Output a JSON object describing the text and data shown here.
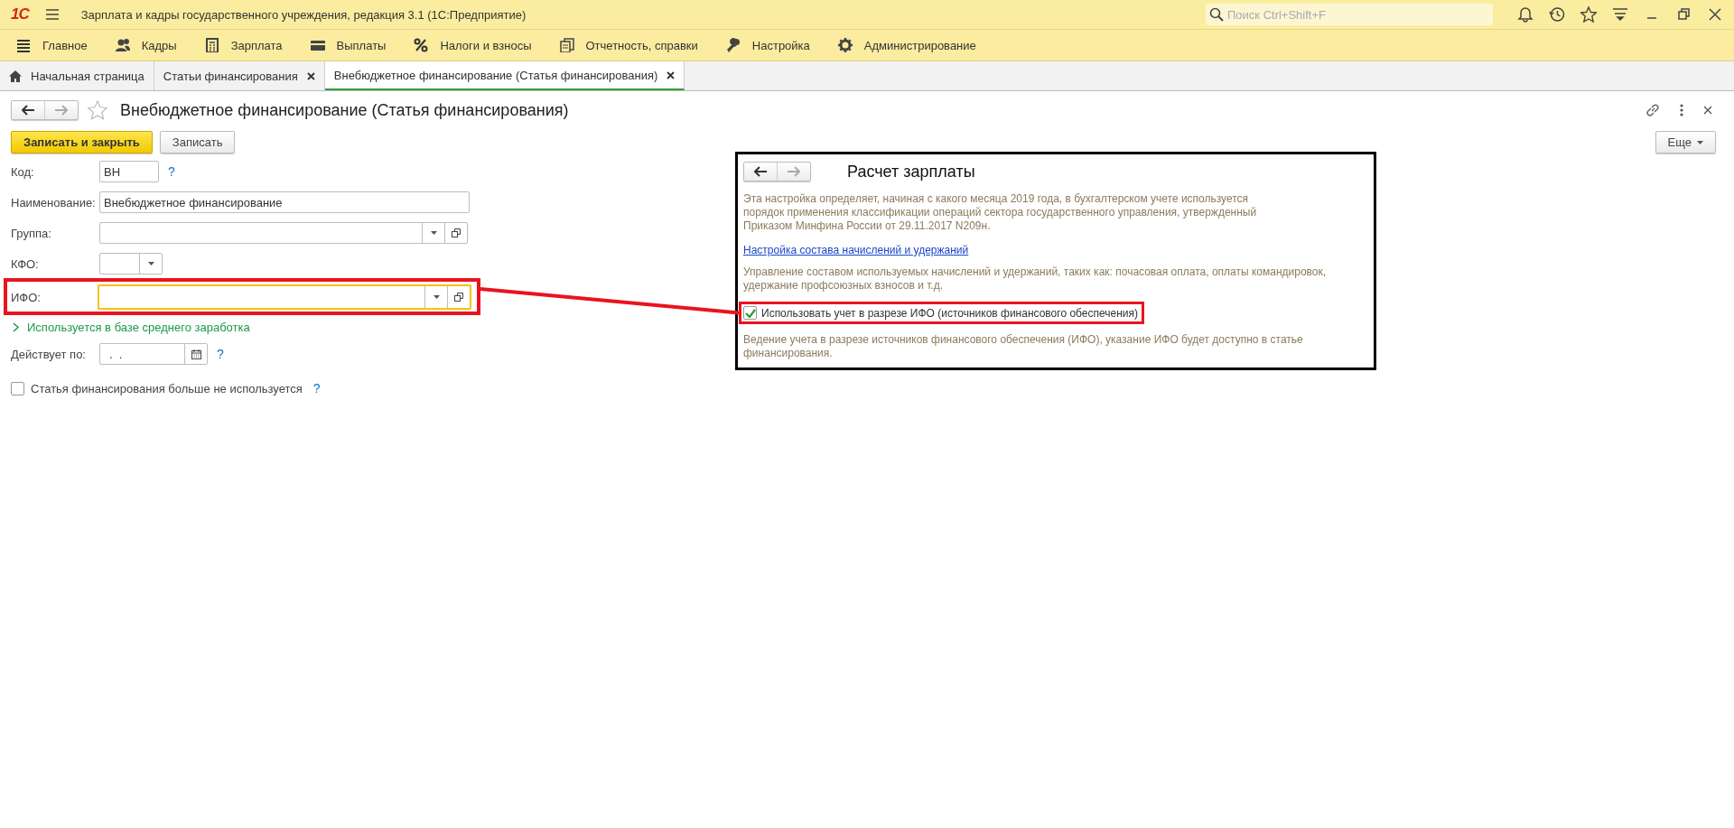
{
  "app": {
    "logo": "1С",
    "title": "Зарплата и кадры государственного учреждения, редакция 3.1  (1С:Предприятие)",
    "search": {
      "placeholder": "Поиск Ctrl+Shift+F"
    }
  },
  "menu": [
    {
      "label": "Главное"
    },
    {
      "label": "Кадры"
    },
    {
      "label": "Зарплата"
    },
    {
      "label": "Выплаты"
    },
    {
      "label": "Налоги и взносы"
    },
    {
      "label": "Отчетность, справки"
    },
    {
      "label": "Настройка"
    },
    {
      "label": "Администрирование"
    }
  ],
  "tabs": [
    {
      "label": "Начальная страница",
      "selected": false,
      "kind": "home"
    },
    {
      "label": "Статьи финансирования",
      "selected": false,
      "kind": "page"
    },
    {
      "label": "Внебюджетное финансирование (Статья финансирования)",
      "selected": true,
      "kind": "page"
    }
  ],
  "form": {
    "title": "Внебюджетное финансирование (Статья финансирования)",
    "favorite": false,
    "buttons": [
      {
        "label": "Записать и закрыть",
        "kind": "primary"
      },
      {
        "label": "Записать",
        "kind": "normal"
      }
    ],
    "more_button": "Еще",
    "rows": [
      {
        "kind": "short_text",
        "label": "Код:",
        "value": "ВН",
        "help": "?",
        "focused": false,
        "highlighted": false
      },
      {
        "kind": "text",
        "label": "Наименование:",
        "value": "Внебюджетное финансирование",
        "focused": false,
        "highlighted": false
      },
      {
        "kind": "ref",
        "label": "Группа:",
        "focused": false,
        "highlighted": false
      },
      {
        "kind": "choice",
        "label": "КФО:",
        "focused": false,
        "highlighted": false
      },
      {
        "kind": "ref",
        "label": "ИФО:",
        "focused": true,
        "highlighted": true
      },
      {
        "kind": "expander",
        "text": "Используется в базе среднего заработка",
        "expanded": false
      },
      {
        "kind": "date",
        "label": "Действует по:",
        "value": ".  .",
        "help": "?",
        "focused": false,
        "highlighted": false
      },
      {
        "kind": "checkbox",
        "label": "Статья финансирования больше не используется",
        "help": "?",
        "checked": false
      }
    ]
  },
  "callout": {
    "title": "Расчет зарплаты",
    "intro": "Эта настройка определяет, начиная с какого месяца 2019 года, в бухгалтерском учете используется\nпорядок применения классификации операций сектора государственного управления, утвержденный\nПриказом Минфина России от 29.11.2017 N209н.",
    "link": "Настройка состава начислений и удержаний",
    "link_note": "Управление составом используемых начислений и удержаний, таких как: почасовая оплата, оплаты командировок,\nудержание профсоюзных взносов и т.д.",
    "checkbox": {
      "label": "Использовать учет в разрезе ИФО (источников финансового обеспечения)",
      "checked": true,
      "highlighted": true
    },
    "note": "Ведение учета в разрезе источников финансового обеспечения (ИФО), указание ИФО будет доступно в статье\nфинансирования."
  }
}
